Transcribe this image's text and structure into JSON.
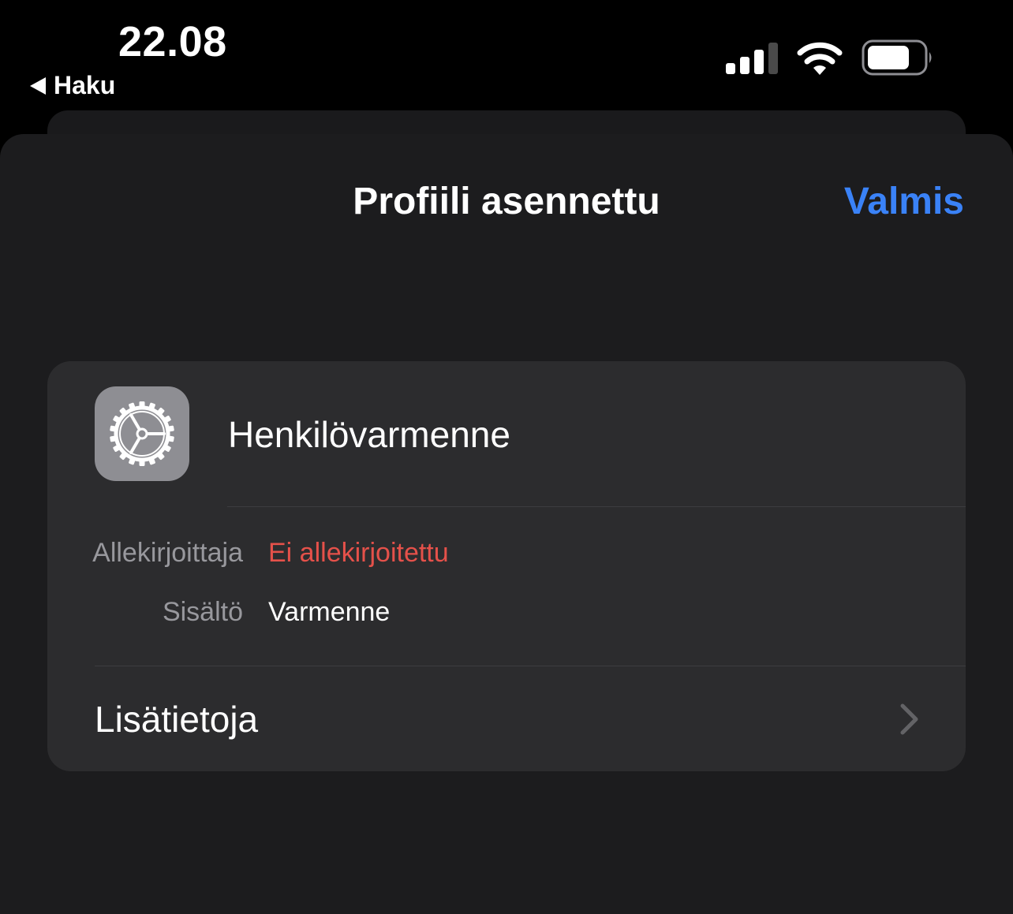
{
  "status_bar": {
    "time": "22.08",
    "back_label": "Haku",
    "icons": [
      "signal-icon",
      "wifi-icon",
      "battery-icon"
    ]
  },
  "sheet": {
    "title": "Profiili asennettu",
    "done_label": "Valmis"
  },
  "profile": {
    "icon": "settings-gear-icon",
    "name": "Henkilövarmenne",
    "details": [
      {
        "label": "Allekirjoittaja",
        "value": "Ei allekirjoitettu"
      },
      {
        "label": "Sisältö",
        "value": "Varmenne"
      }
    ],
    "more_label": "Lisätietoja"
  },
  "colors": {
    "accent": "#3a82f7",
    "warning": "#e5514a",
    "sheet_bg": "#1c1c1e",
    "card_bg": "#2c2c2e"
  }
}
